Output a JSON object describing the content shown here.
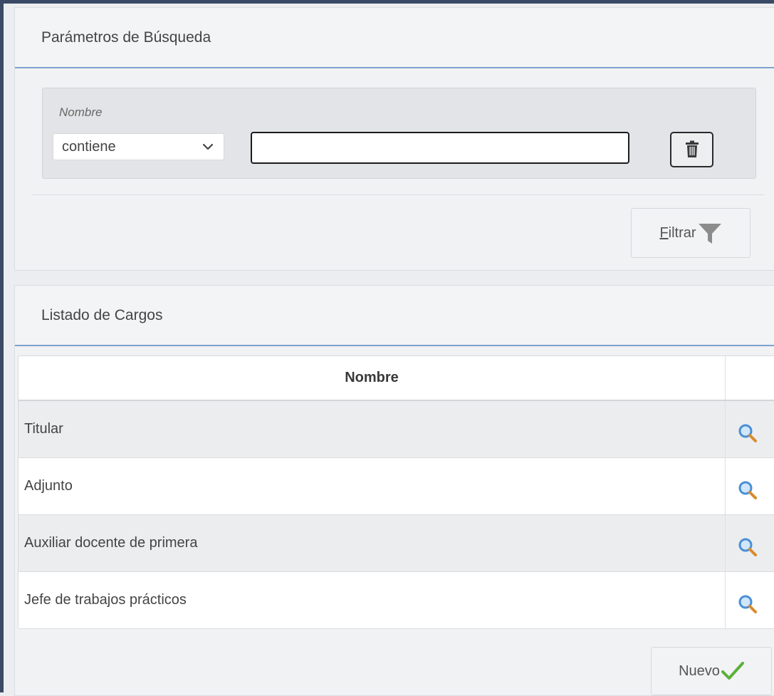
{
  "search_panel": {
    "title": "Parámetros de Búsqueda",
    "field_label": "Nombre",
    "operator_value": "contiene",
    "text_value": "",
    "filter_button_accesskey": "F",
    "filter_button_rest": "iltrar"
  },
  "list_panel": {
    "title": "Listado de Cargos",
    "column_header": "Nombre",
    "rows": [
      {
        "name": "Titular"
      },
      {
        "name": "Adjunto"
      },
      {
        "name": "Auxiliar docente de primera"
      },
      {
        "name": "Jefe de trabajos prácticos"
      }
    ],
    "new_button_label": "Nuevo"
  },
  "icons": {
    "operator_chevron": "chevron-down-icon",
    "clear": "trash-icon",
    "filter": "funnel-icon",
    "row_action": "magnifier-icon",
    "new": "checkmark-icon"
  },
  "colors": {
    "panel_rule": "#7ea1cf",
    "frame": "#3a4a66",
    "check_green": "#5cb03a",
    "magnifier_blue": "#4a8fd4",
    "magnifier_handle": "#d98a2c"
  }
}
